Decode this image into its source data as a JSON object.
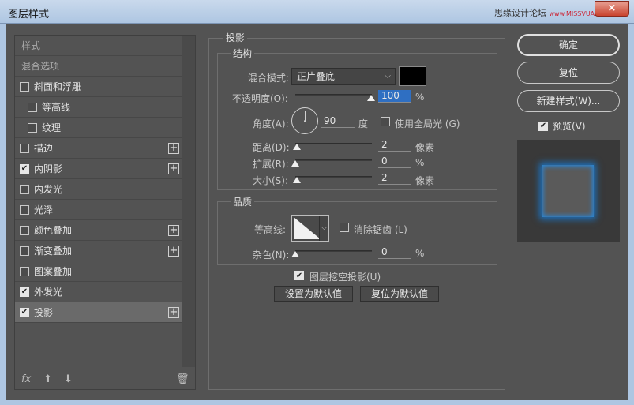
{
  "window": {
    "title": "图层样式",
    "watermark": "思缘设计论坛",
    "watermark_url": "www.MISSVUAN.com",
    "close_label": "×"
  },
  "left_panel": {
    "items": [
      {
        "label": "样式",
        "type": "header"
      },
      {
        "label": "混合选项",
        "type": "header"
      },
      {
        "label": "斜面和浮雕",
        "checked": false,
        "plus": false,
        "indent": 0
      },
      {
        "label": "等高线",
        "checked": false,
        "plus": false,
        "indent": 1
      },
      {
        "label": "纹理",
        "checked": false,
        "plus": false,
        "indent": 1
      },
      {
        "label": "描边",
        "checked": false,
        "plus": true,
        "indent": 0
      },
      {
        "label": "内阴影",
        "checked": true,
        "plus": true,
        "indent": 0
      },
      {
        "label": "内发光",
        "checked": false,
        "plus": false,
        "indent": 0
      },
      {
        "label": "光泽",
        "checked": false,
        "plus": false,
        "indent": 0
      },
      {
        "label": "颜色叠加",
        "checked": false,
        "plus": true,
        "indent": 0
      },
      {
        "label": "渐变叠加",
        "checked": false,
        "plus": true,
        "indent": 0
      },
      {
        "label": "图案叠加",
        "checked": false,
        "plus": false,
        "indent": 0
      },
      {
        "label": "外发光",
        "checked": true,
        "plus": false,
        "indent": 0
      },
      {
        "label": "投影",
        "checked": true,
        "plus": true,
        "indent": 0,
        "active": true
      }
    ],
    "fx_label": "fx"
  },
  "drop_shadow": {
    "section_title": "投影",
    "structure_title": "结构",
    "blend_mode_label": "混合模式:",
    "blend_mode_value": "正片叠底",
    "shadow_color": "#000000",
    "opacity_label": "不透明度(O):",
    "opacity_value": "100",
    "opacity_unit": "%",
    "angle_label": "角度(A):",
    "angle_value": "90",
    "angle_unit": "度",
    "global_light_label": "使用全局光 (G)",
    "global_light_checked": false,
    "distance_label": "距离(D):",
    "distance_value": "2",
    "distance_unit": "像素",
    "spread_label": "扩展(R):",
    "spread_value": "0",
    "spread_unit": "%",
    "size_label": "大小(S):",
    "size_value": "2",
    "size_unit": "像素",
    "quality_title": "品质",
    "contour_label": "等高线:",
    "antialias_label": "消除锯齿 (L)",
    "antialias_checked": false,
    "noise_label": "杂色(N):",
    "noise_value": "0",
    "noise_unit": "%",
    "knockout_label": "图层挖空投影(U)",
    "knockout_checked": true,
    "make_default_label": "设置为默认值",
    "reset_default_label": "复位为默认值"
  },
  "right_panel": {
    "ok_label": "确定",
    "reset_label": "复位",
    "new_style_label": "新建样式(W)...",
    "preview_label": "预览(V)",
    "preview_checked": true,
    "glow_color": "#1e6fb8"
  }
}
